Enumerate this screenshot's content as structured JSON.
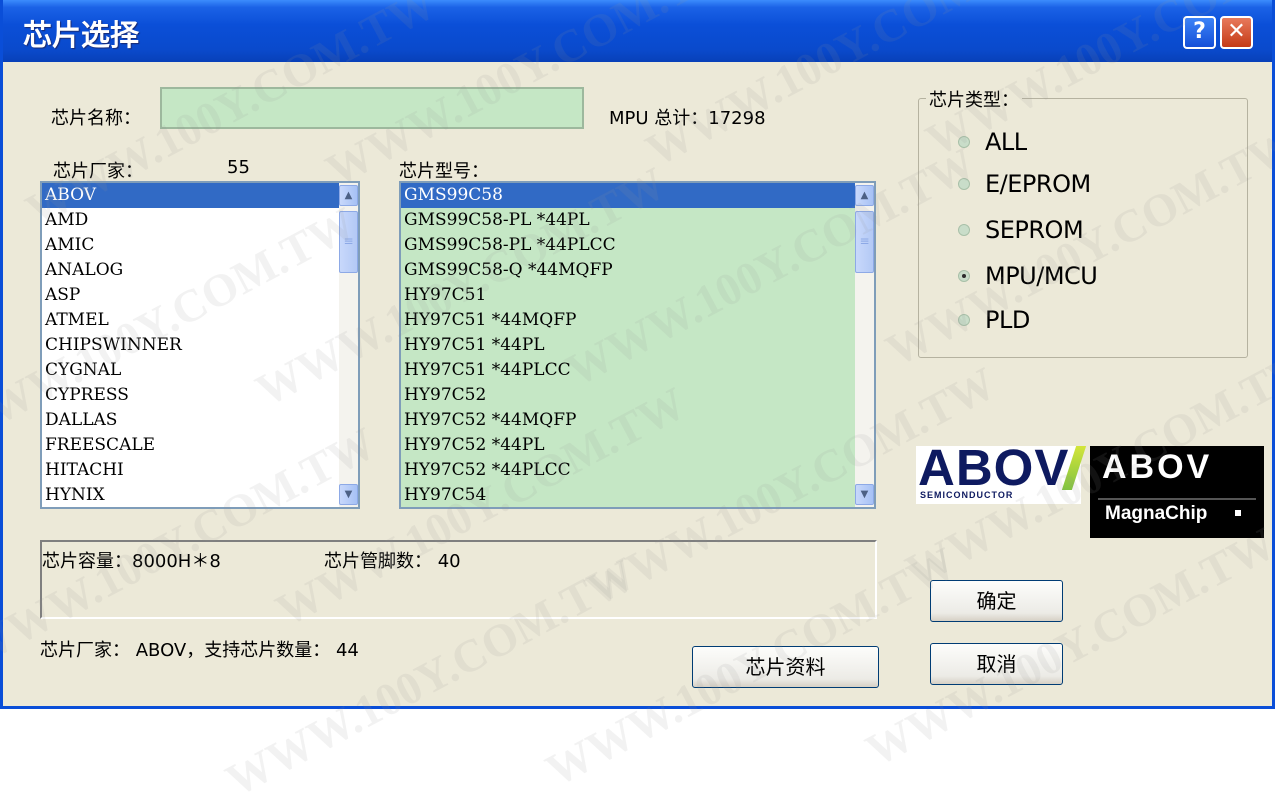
{
  "window": {
    "title": "芯片选择",
    "help_label": "?",
    "close_label": "✕",
    "help_icon": "question-mark-icon",
    "close_icon": "close-x-icon"
  },
  "chip_name": {
    "label": "芯片名称：",
    "value": ""
  },
  "mpu_total": "MPU 总计：17298",
  "vendor": {
    "label": "芯片厂家：",
    "count": "55",
    "items": [
      "ABOV",
      "AMD",
      "AMIC",
      "ANALOG",
      "ASP",
      "ATMEL",
      "CHIPSWINNER",
      "CYGNAL",
      "CYPRESS",
      "DALLAS",
      "FREESCALE",
      "HITACHI",
      "HYNIX"
    ],
    "selected_index": 0
  },
  "model": {
    "label": "芯片型号：",
    "items": [
      "GMS99C58",
      "GMS99C58-PL *44PL",
      "GMS99C58-PL *44PLCC",
      "GMS99C58-Q *44MQFP",
      "HY97C51",
      "HY97C51 *44MQFP",
      "HY97C51 *44PL",
      "HY97C51 *44PLCC",
      "HY97C52",
      "HY97C52 *44MQFP",
      "HY97C52 *44PL",
      "HY97C52 *44PLCC",
      "HY97C54"
    ],
    "selected_index": 0
  },
  "chip_type": {
    "label": "芯片类型：",
    "options": [
      "ALL",
      "E/EPROM",
      "SEPROM",
      "MPU/MCU",
      "PLD"
    ],
    "selected": "MPU/MCU"
  },
  "info": {
    "capacity": "芯片容量：8000H＊8",
    "pins": "芯片管脚数： 40"
  },
  "status_line": "芯片厂家： ABOV，支持芯片数量： 44",
  "buttons": {
    "ok": "确定",
    "cancel": "取消",
    "datasheet": "芯片资料"
  },
  "logos": {
    "abov_semiconductor": {
      "name": "ABOV",
      "sub": "SEMICONDUCTOR"
    },
    "abov_magnachip": {
      "name": "ABOV",
      "sub": "MagnaChip"
    }
  },
  "watermark": "WWW.100Y.COM.TW",
  "colors": {
    "titlebar": "#0A4ED8",
    "dialog_bg": "#ECE9D8",
    "green_field": "#C5E7C5",
    "selection": "#316AC5"
  }
}
